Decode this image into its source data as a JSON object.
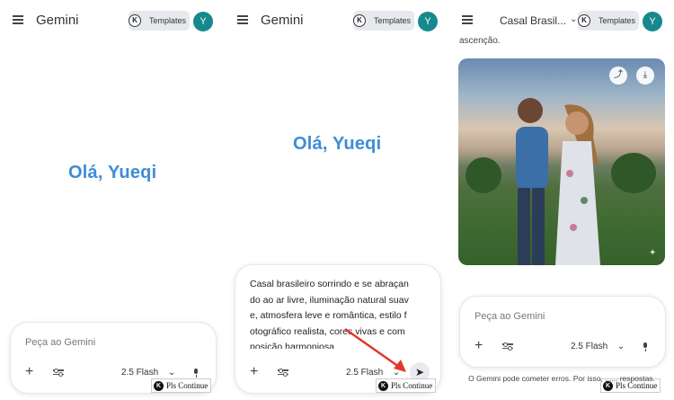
{
  "brand": "Gemini",
  "templates_label": "Templates",
  "k_glyph": "K",
  "avatar_initial": "Y",
  "greeting": "Olá, Yueqi",
  "composer": {
    "placeholder": "Peça ao Gemini",
    "model": "2.5 Flash",
    "model_chevron": "⌄",
    "plus": "+",
    "send": "➤"
  },
  "prompt_lines": [
    "Casal brasileiro sorrindo e se abraçan",
    "do ao ar livre, iluminação natural suav",
    "e, atmosfera leve e romântica, estilo f",
    "otográfico realista, cores vivas e com",
    "posição harmoniosa."
  ],
  "chat_title": "Casal Brasil...",
  "chat_title_chevron": "⌄",
  "cut_text": "ascenção.",
  "disclaimer": "O Gemini pode cometer erros. Por isso, ...... respostas.",
  "pls_continue": "Pls Continue",
  "icons": {
    "share": "⤴",
    "download": "⤓",
    "sparkle": "✦"
  }
}
